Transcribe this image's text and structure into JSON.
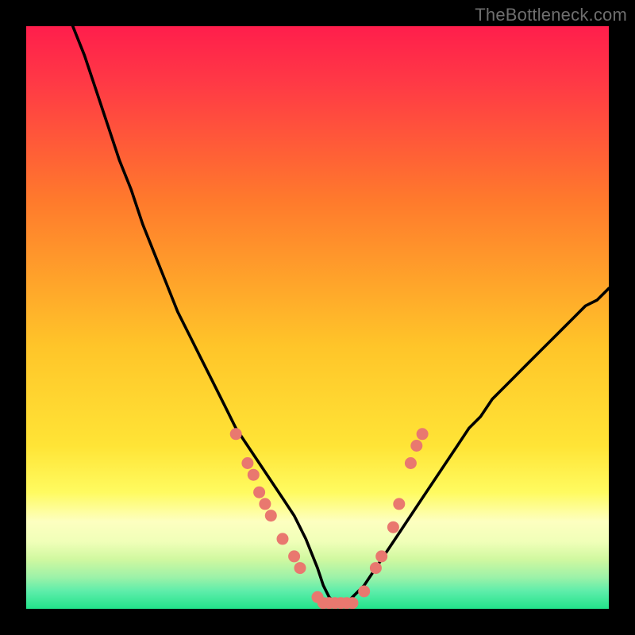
{
  "watermark": "TheBottleneck.com",
  "colors": {
    "gradient_top": "#ff1e4c",
    "gradient_mid1": "#ff7a2c",
    "gradient_mid2": "#ffe436",
    "gradient_band1": "#fff9a0",
    "gradient_band2": "#d9f79b",
    "gradient_bottom": "#26e68c",
    "curve": "#000000",
    "marker": "#e9786f"
  },
  "chart_data": {
    "type": "line",
    "title": "",
    "xlabel": "",
    "ylabel": "",
    "xlim": [
      0,
      100
    ],
    "ylim": [
      0,
      100
    ],
    "series": [
      {
        "name": "bottleneck-curve",
        "x": [
          8,
          10,
          12,
          14,
          16,
          18,
          20,
          22,
          24,
          26,
          28,
          30,
          32,
          34,
          36,
          38,
          40,
          42,
          44,
          46,
          48,
          50,
          51,
          52,
          53,
          54,
          55,
          56,
          58,
          60,
          62,
          64,
          66,
          68,
          70,
          72,
          74,
          76,
          78,
          80,
          82,
          84,
          86,
          88,
          90,
          92,
          94,
          96,
          98,
          100
        ],
        "y": [
          100,
          95,
          89,
          83,
          77,
          72,
          66,
          61,
          56,
          51,
          47,
          43,
          39,
          35,
          31,
          28,
          25,
          22,
          19,
          16,
          12,
          7,
          4,
          2,
          1,
          1,
          1,
          2,
          4,
          7,
          10,
          13,
          16,
          19,
          22,
          25,
          28,
          31,
          33,
          36,
          38,
          40,
          42,
          44,
          46,
          48,
          50,
          52,
          53,
          55
        ]
      }
    ],
    "markers": [
      {
        "x": 36,
        "y": 30
      },
      {
        "x": 38,
        "y": 25
      },
      {
        "x": 39,
        "y": 23
      },
      {
        "x": 40,
        "y": 20
      },
      {
        "x": 41,
        "y": 18
      },
      {
        "x": 42,
        "y": 16
      },
      {
        "x": 44,
        "y": 12
      },
      {
        "x": 46,
        "y": 9
      },
      {
        "x": 47,
        "y": 7
      },
      {
        "x": 50,
        "y": 2
      },
      {
        "x": 51,
        "y": 1
      },
      {
        "x": 52,
        "y": 1
      },
      {
        "x": 53,
        "y": 1
      },
      {
        "x": 54,
        "y": 1
      },
      {
        "x": 55,
        "y": 1
      },
      {
        "x": 56,
        "y": 1
      },
      {
        "x": 58,
        "y": 3
      },
      {
        "x": 60,
        "y": 7
      },
      {
        "x": 61,
        "y": 9
      },
      {
        "x": 63,
        "y": 14
      },
      {
        "x": 64,
        "y": 18
      },
      {
        "x": 66,
        "y": 25
      },
      {
        "x": 67,
        "y": 28
      },
      {
        "x": 68,
        "y": 30
      }
    ]
  }
}
